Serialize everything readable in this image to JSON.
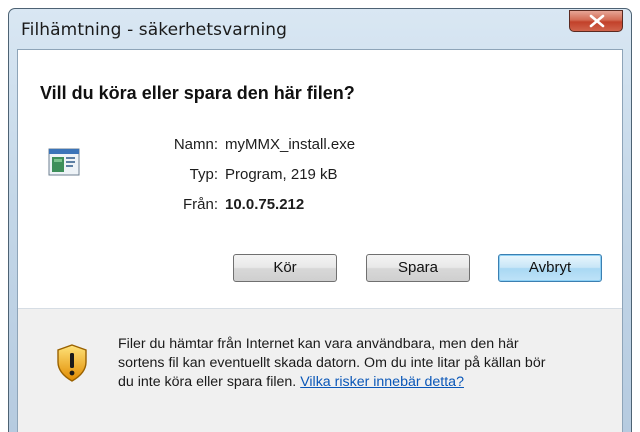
{
  "window": {
    "title": "Filhämtning - säkerhetsvarning",
    "close_label": "X"
  },
  "dialog": {
    "question": "Vill du köra eller spara den här filen?",
    "details": {
      "name_label": "Namn:",
      "name_value": "myMMX_install.exe",
      "type_label": "Typ:",
      "type_value": "Program, 219 kB",
      "from_label": "Från:",
      "from_value": "10.0.75.212"
    },
    "buttons": {
      "run": "Kör",
      "save": "Spara",
      "cancel": "Avbryt"
    }
  },
  "warning": {
    "text_line1": "Filer du hämtar från Internet kan vara användbara, men den här",
    "text_line2": "sortens fil kan eventuellt skada datorn. Om du inte litar på källan bör",
    "text_line3": "du inte köra eller spara filen.",
    "link": "Vilka risker innebär detta?"
  },
  "icons": {
    "file": "program-file-icon",
    "shield": "security-shield-warning-icon"
  },
  "colors": {
    "title_gradient_top": "#d9e7f3",
    "close_red": "#c2412a",
    "link_blue": "#0a57b8",
    "default_button": "#a9d8f3"
  }
}
